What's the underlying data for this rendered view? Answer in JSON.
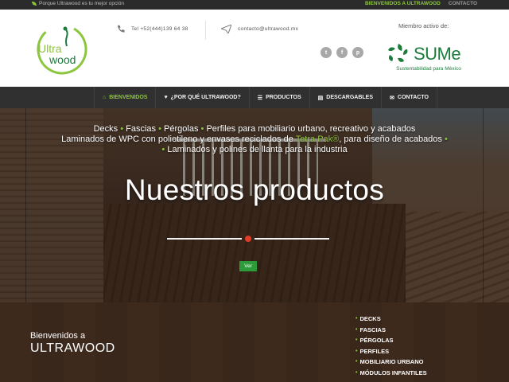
{
  "topbar": {
    "tagline": "Porque Ultrawood es tu mejor opción",
    "links": [
      "BIENVENIDOS A ULTRAWOOD",
      "CONTACTO"
    ]
  },
  "header": {
    "logo_text": [
      "Ultra",
      "wood"
    ],
    "phone": "Tel +52(444)139 64 38",
    "email": "contacto@ultrawood.mx",
    "social_icons": [
      "twitter-icon",
      "facebook-icon",
      "pinterest-icon"
    ],
    "social_glyphs": [
      "t",
      "f",
      "p"
    ],
    "member_label": "Miembro activo de:",
    "sume_word": "SUMe",
    "sume_sub": "Sustentabilidad para México"
  },
  "nav": {
    "items": [
      {
        "label": "BIENVENIDOS",
        "icon": "home-icon",
        "glyph": "⌂",
        "active": true
      },
      {
        "label": "¿POR QUÉ ULTRAWOOD?",
        "icon": "heart-icon",
        "glyph": "♥",
        "active": false
      },
      {
        "label": "PRODUCTOS",
        "icon": "list-icon",
        "glyph": "☰",
        "active": false
      },
      {
        "label": "DESCARGABLES",
        "icon": "document-icon",
        "glyph": "▤",
        "active": false
      },
      {
        "label": "CONTACTO",
        "icon": "mail-icon",
        "glyph": "✉",
        "active": false
      }
    ]
  },
  "hero": {
    "line1": [
      "Decks",
      "Fascias",
      "Pérgolas",
      "Perfiles para mobiliario urbano, recreativo y acabados"
    ],
    "line2_a": "Laminados de WPC con polietileno y envases reciclados de ",
    "line2_hl": "Tetra Pak®",
    "line2_b": ", para diseño de acabados",
    "line3": "Laminados y polines de llanta para la industria",
    "title": "Nuestros productos",
    "button": "Ver"
  },
  "footer": {
    "welcome": "Bienvenidos a",
    "brand": "ULTRAWOOD",
    "products": [
      "DECKS",
      "FASCIAS",
      "PÉRGOLAS",
      "PERFILES",
      "MOBILIARIO URBANO",
      "MÓDULOS INFANTILES"
    ]
  },
  "colors": {
    "accent": "#8cc63f",
    "dark": "#303030",
    "button": "#2e9b3a",
    "dot": "#e33b2a"
  }
}
